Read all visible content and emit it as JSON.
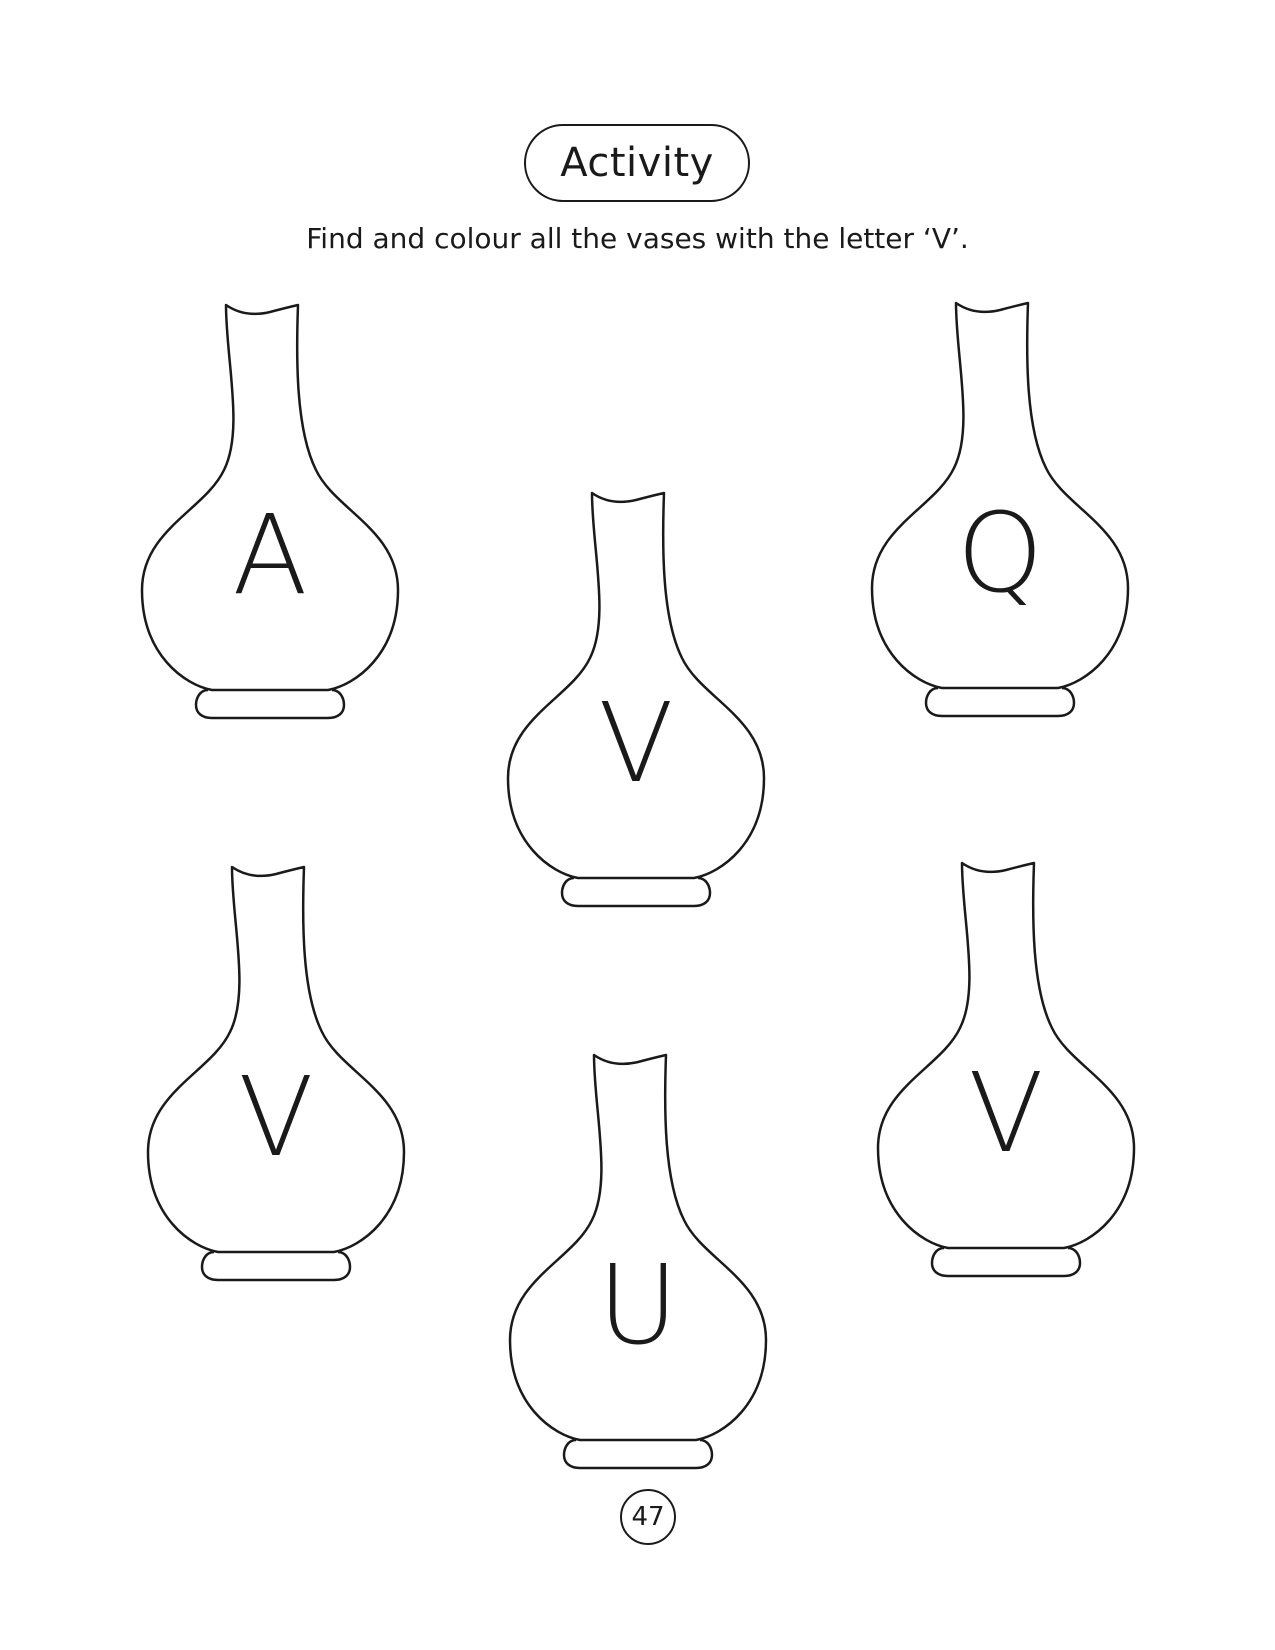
{
  "header": {
    "title": "Activity",
    "instruction": "Find and colour all the vases with the letter ‘V’."
  },
  "vases": [
    {
      "letter": "A"
    },
    {
      "letter": "V"
    },
    {
      "letter": "Q"
    },
    {
      "letter": "V"
    },
    {
      "letter": "U"
    },
    {
      "letter": "V"
    }
  ],
  "footer": {
    "page_number": "47"
  }
}
